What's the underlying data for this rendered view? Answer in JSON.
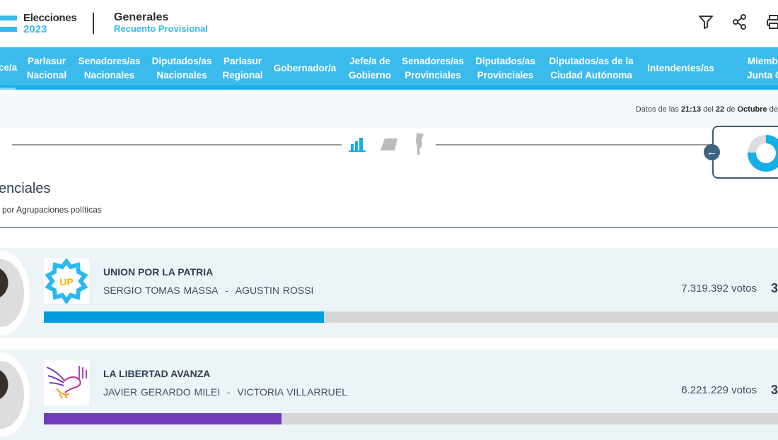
{
  "header": {
    "logo_line1": "Elecciones",
    "logo_line2": "2023",
    "election_type": "Generales",
    "count_type": "Recuento Provisional",
    "icons": [
      "filter-icon",
      "share-icon",
      "print-icon"
    ]
  },
  "nav": {
    "tabs": [
      {
        "line1": "ce/a",
        "line2": "",
        "active": true
      },
      {
        "line1": "Parlasur",
        "line2": "Nacional"
      },
      {
        "line1": "Senadores/as",
        "line2": "Nacionales"
      },
      {
        "line1": "Diputados/as",
        "line2": "Nacionales"
      },
      {
        "line1": "Parlasur",
        "line2": "Regional"
      },
      {
        "line1": "Gobernador/a",
        "line2": ""
      },
      {
        "line1": "Jefe/a de",
        "line2": "Gobierno"
      },
      {
        "line1": "Senadores/as",
        "line2": "Provinciales"
      },
      {
        "line1": "Diputados/as",
        "line2": "Provinciales"
      },
      {
        "line1": "Diputados/as de la",
        "line2": "Ciudad Autónoma"
      },
      {
        "line1": "Intendentes/as",
        "line2": ""
      },
      {
        "line1": "Miembro",
        "line2": "Junta Co"
      }
    ]
  },
  "info": {
    "prefix": "Datos de las",
    "time": "21:13",
    "del": "del",
    "day": "22",
    "de": "de",
    "month": "Octubre",
    "suffix": "de"
  },
  "view_icons": [
    "bar-chart-icon",
    "ballot-box-icon",
    "argentina-map-icon"
  ],
  "section": {
    "title": "enciales",
    "subtitle": "por Agrupaciones políticas"
  },
  "colors": {
    "accent": "#3bbbec",
    "union": "#009ddc",
    "libertad": "#6f3bb8"
  },
  "results": [
    {
      "party": "UNION POR LA PATRIA",
      "candidate1": "SERGIO TOMAS MASSA",
      "separator": "-",
      "candidate2": "AGUSTIN ROSSI",
      "votes": "7.319.392 votos",
      "percent": "3",
      "fill_percent": 36.7,
      "color": "#009ddc"
    },
    {
      "party": "LA LIBERTAD AVANZA",
      "candidate1": "JAVIER GERARDO MILEI",
      "separator": "-",
      "candidate2": "VICTORIA VILLARRUEL",
      "votes": "6.221.229 votos",
      "percent": "3",
      "fill_percent": 31.2,
      "color": "#6f3bb8"
    }
  ]
}
